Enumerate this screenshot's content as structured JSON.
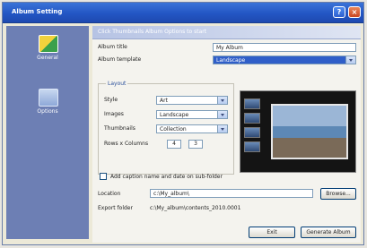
{
  "window": {
    "title": "Album Setting"
  },
  "titlebar_buttons": [
    {
      "glyph": "?"
    },
    {
      "glyph": "×"
    }
  ],
  "sidebar": {
    "items": [
      {
        "label": "General",
        "icon": "album-settings-icon"
      },
      {
        "label": "Options",
        "icon": "options-icon"
      }
    ]
  },
  "panel": {
    "banner": "Click Thumbnails Album Options to start",
    "album_title": {
      "label": "Album title",
      "value": "My Album"
    },
    "album_template": {
      "label": "Album template",
      "value": "Landscape"
    },
    "layout": {
      "title": "Layout",
      "style": {
        "label": "Style",
        "value": "Art"
      },
      "images": {
        "label": "Images",
        "value": "Landscape"
      },
      "thumbnails": {
        "label": "Thumbnails",
        "value": "Collection"
      },
      "rows_columns": {
        "label": "Rows x Columns",
        "rows": "4",
        "cols": "3"
      }
    },
    "add_caption": {
      "label": "Add caption name and date on sub-folder",
      "checked": false
    },
    "location": {
      "label": "Location",
      "value": "c:\\My_album\\",
      "browse": "Browse..."
    },
    "output": {
      "label": "Export folder",
      "value": "c:\\My_album\\contents_2010.0001"
    }
  },
  "footer": {
    "exit": "Exit",
    "generate": "Generate Album"
  }
}
